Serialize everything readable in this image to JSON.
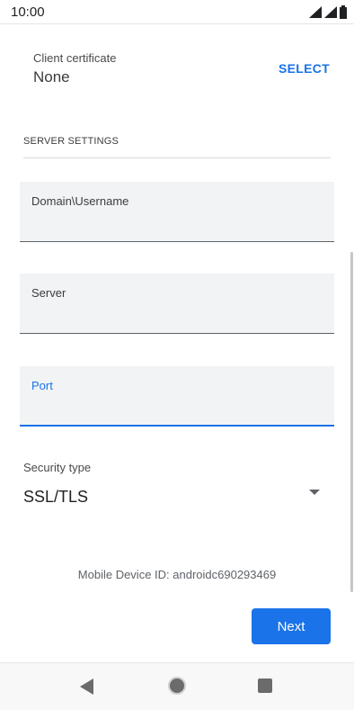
{
  "status_bar": {
    "time": "10:00",
    "icons": [
      "signal-icon",
      "signal-icon",
      "battery-icon"
    ]
  },
  "client_certificate": {
    "label": "Client certificate",
    "value": "None",
    "select_label": "SELECT"
  },
  "server_settings": {
    "header": "SERVER SETTINGS",
    "fields": [
      {
        "name": "domain-username",
        "label": "Domain\\Username",
        "value": "",
        "focused": false
      },
      {
        "name": "server",
        "label": "Server",
        "value": "",
        "focused": false
      },
      {
        "name": "port",
        "label": "Port",
        "value": "",
        "focused": true
      }
    ]
  },
  "security": {
    "label": "Security type",
    "value": "SSL/TLS"
  },
  "device_id": "Mobile Device ID: androidc690293469",
  "next_label": "Next",
  "colors": {
    "accent": "#1a73e8",
    "field_bg": "#f1f3f4",
    "text": "#202124"
  },
  "nav_bar": {
    "icons": [
      "back-icon",
      "home-icon",
      "recents-icon"
    ]
  }
}
